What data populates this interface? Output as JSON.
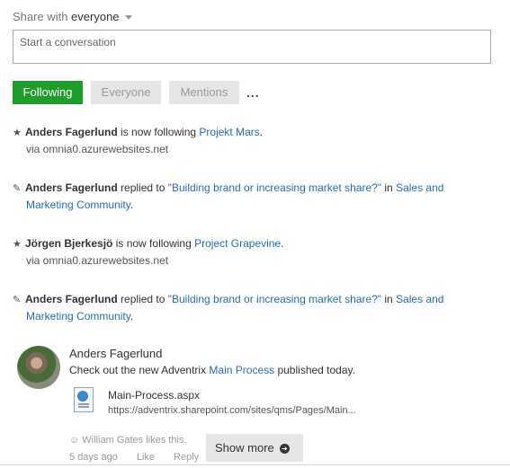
{
  "share": {
    "prefix": "Share with",
    "audience": "everyone"
  },
  "compose": {
    "placeholder": "Start a conversation"
  },
  "tabs": [
    {
      "label": "Following",
      "active": true
    },
    {
      "label": "Everyone",
      "active": false
    },
    {
      "label": "Mentions",
      "active": false
    }
  ],
  "more_label": "...",
  "feed": [
    {
      "icon": "star-icon",
      "who": "Anders Fagerlund",
      "action": " is now following ",
      "target": "Projekt Mars",
      "suffix": ".",
      "via": "via omnia0.azurewebsites.net"
    },
    {
      "icon": "pencil-icon",
      "who": "Anders Fagerlund",
      "action": " replied to ",
      "target": "\"Building brand or increasing market share?\"",
      "mid": " in ",
      "target2a": "Sales and",
      "target2b": "Marketing Community",
      "suffix": "."
    },
    {
      "icon": "star-icon",
      "who": "Jörgen Bjerkesjö",
      "action": " is now following ",
      "target": "Project Grapevine",
      "suffix": ".",
      "via": "via omnia0.azurewebsites.net"
    },
    {
      "icon": "pencil-icon",
      "who": "Anders Fagerlund",
      "action": " replied to ",
      "target": "\"Building brand or increasing market share?\"",
      "mid": " in ",
      "target2a": "Sales and",
      "target2b": "Marketing Community",
      "suffix": "."
    }
  ],
  "post": {
    "author": "Anders Fagerlund",
    "msg_pre": "Check out the new Adventrix ",
    "msg_link": "Main Process",
    "msg_post": " published today.",
    "doc_name": "Main-Process.aspx",
    "doc_url": "https://adventrix.sharepoint.com/sites/qms/Pages/Main...",
    "likes": "William Gates likes this.",
    "time": "5 days ago",
    "like_label": "Like",
    "reply_label": "Reply",
    "show_more": "Show more"
  },
  "icons": {
    "smiley": "☺",
    "star": "★",
    "pencil": "✎",
    "arrow": "➔"
  }
}
